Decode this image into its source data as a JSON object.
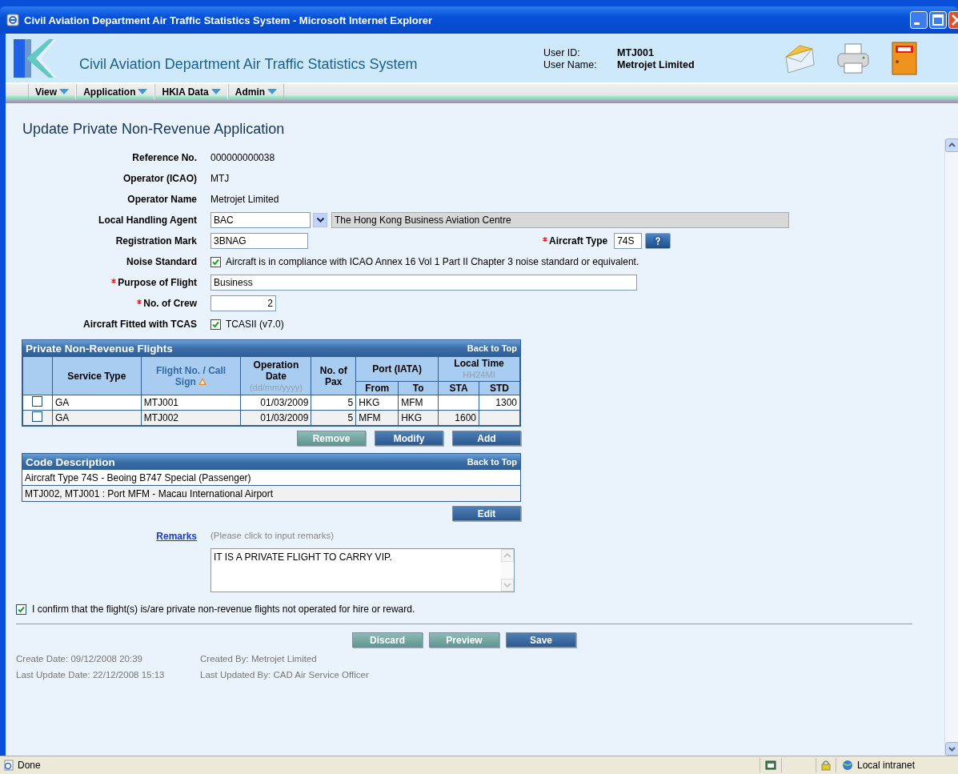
{
  "window": {
    "title": "Civil Aviation Department Air Traffic Statistics System - Microsoft Internet Explorer"
  },
  "header": {
    "title": "Civil Aviation Department Air Traffic Statistics System",
    "user_id_label": "User ID:",
    "user_id": "MTJ001",
    "user_name_label": "User Name:",
    "user_name": "Metrojet Limited"
  },
  "menu": [
    {
      "label": "View"
    },
    {
      "label": "Application"
    },
    {
      "label": "HKIA Data"
    },
    {
      "label": "Admin"
    }
  ],
  "page_title": "Update Private Non-Revenue Application",
  "fields": [
    {
      "kind": "text",
      "label": "Reference No.",
      "value": "000000000038"
    },
    {
      "kind": "text",
      "label": "Operator (ICAO)",
      "value": "MTJ"
    },
    {
      "kind": "text",
      "label": "Operator Name",
      "value": "Metrojet Limited"
    },
    {
      "kind": "select",
      "label": "Local Handling Agent",
      "value": "BAC",
      "description": "The Hong Kong Business Aviation Centre"
    },
    {
      "kind": "input_pair",
      "label": "Registration Mark",
      "value": "3BNAG",
      "required": false,
      "second_label": "Aircraft Type",
      "second_value": "74S",
      "second_required": true
    },
    {
      "kind": "checkbox",
      "label": "Noise Standard",
      "text": "Aircraft is in compliance with ICAO Annex 16 Vol 1 Part II Chapter 3 noise standard or equivalent.",
      "checked": true
    },
    {
      "kind": "input_wide",
      "label": "Purpose of Flight",
      "value": "Business",
      "required": true
    },
    {
      "kind": "input_number",
      "label": "No. of Crew",
      "value": "2",
      "required": true
    },
    {
      "kind": "checkbox",
      "label": "Aircraft Fitted with TCAS",
      "text": "TCASII (v7.0)",
      "checked": true
    }
  ],
  "flights": {
    "title": "Private Non-Revenue Flights",
    "back_link": "Back to Top",
    "headers": {
      "service_type": "Service Type",
      "flight_no": "Flight No. / Call Sign",
      "operation_date": "Operation Date",
      "date_format": "(dd/mm/yyyy)",
      "pax": "No. of Pax",
      "port": "Port (IATA)",
      "from": "From",
      "to": "To",
      "local_time": "Local Time",
      "time_format": "HH24MI",
      "sta": "STA",
      "std": "STD"
    },
    "rows": [
      {
        "selected": false,
        "service_type": "GA",
        "flight_no": "MTJ001",
        "date": "01/03/2009",
        "pax": "5",
        "from": "HKG",
        "to": "MFM",
        "std": "1300"
      },
      {
        "selected": false,
        "service_type": "GA",
        "flight_no": "MTJ002",
        "date": "01/03/2009",
        "pax": "5",
        "from": "MFM",
        "to": "HKG",
        "sta": "1600"
      }
    ],
    "buttons": [
      {
        "label": "Remove",
        "kind": "secondary"
      },
      {
        "label": "Modify",
        "kind": "primary"
      },
      {
        "label": "Add",
        "kind": "primary"
      }
    ]
  },
  "code_description": {
    "title": "Code Description",
    "back_link": "Back to Top",
    "lines": [
      "Aircraft Type 74S - Beoing B747 Special (Passenger)",
      "MTJ002, MTJ001 : Port MFM - Macau International Airport"
    ],
    "buttons": [
      {
        "label": "Edit",
        "kind": "primary"
      }
    ]
  },
  "remarks": {
    "label": "Remarks",
    "hint": "(Please click to input remarks)",
    "value": "IT IS A PRIVATE FLIGHT TO CARRY VIP."
  },
  "confirm": {
    "checked": true,
    "text": "I confirm that the flight(s) is/are private non-revenue flights not operated for hire or reward."
  },
  "actions": [
    {
      "label": "Discard",
      "kind": "secondary"
    },
    {
      "label": "Preview",
      "kind": "secondary"
    },
    {
      "label": "Save",
      "kind": "primary"
    }
  ],
  "audit": [
    {
      "label": "Create Date: 09/12/2008 20:39",
      "by": "Created By: Metrojet Limited"
    },
    {
      "label": "Last Update Date: 22/12/2008 15:13",
      "by": "Last Updated By: CAD Air Service Officer"
    }
  ],
  "status_bar": {
    "text": "Done",
    "zone": "Local intranet"
  }
}
